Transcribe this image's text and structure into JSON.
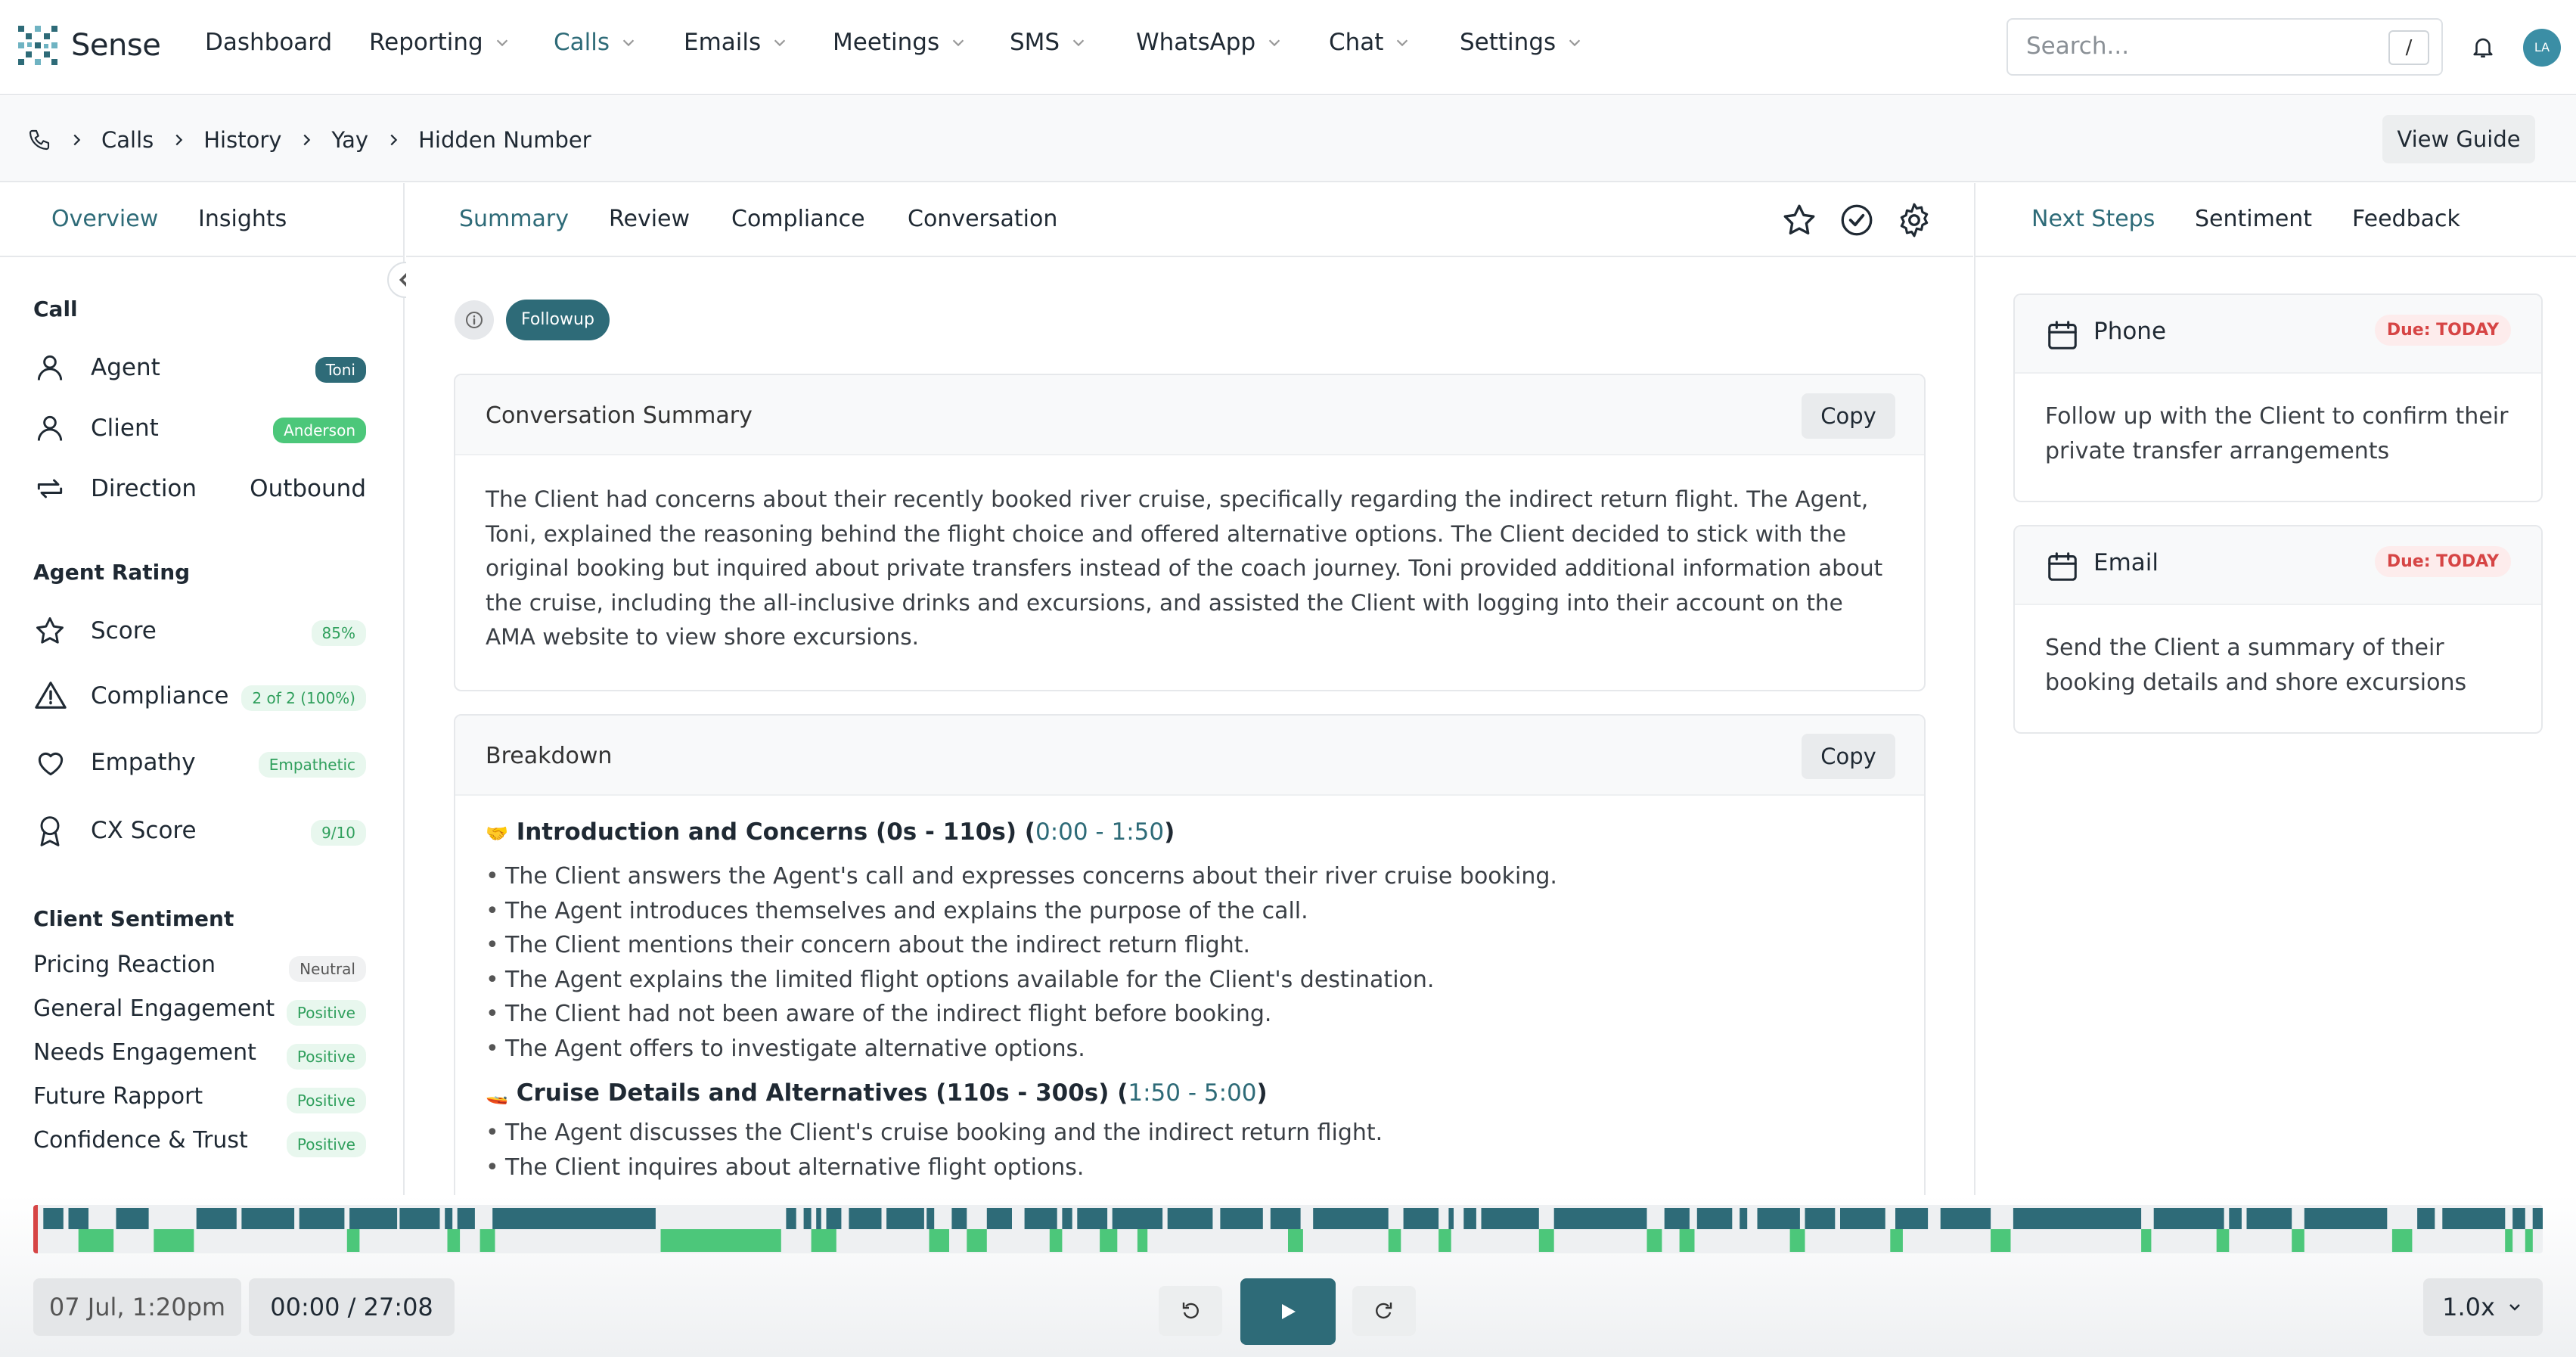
{
  "brand": {
    "name": "Sense"
  },
  "nav": {
    "items": [
      {
        "label": "Dashboard",
        "dropdown": false
      },
      {
        "label": "Reporting",
        "dropdown": true
      },
      {
        "label": "Calls",
        "dropdown": true,
        "active": true
      },
      {
        "label": "Emails",
        "dropdown": true
      },
      {
        "label": "Meetings",
        "dropdown": true
      },
      {
        "label": "SMS",
        "dropdown": true
      },
      {
        "label": "WhatsApp",
        "dropdown": true
      },
      {
        "label": "Chat",
        "dropdown": true
      },
      {
        "label": "Settings",
        "dropdown": true
      }
    ],
    "search_placeholder": "Search...",
    "search_shortcut": "/",
    "avatar_initials": "LA"
  },
  "breadcrumb": {
    "items": [
      "Calls",
      "History",
      "Yay",
      "Hidden Number"
    ],
    "view_guide": "View Guide"
  },
  "left": {
    "tabs": [
      "Overview",
      "Insights"
    ],
    "call_section": "Call",
    "call": {
      "agent_label": "Agent",
      "agent_value": "Toni",
      "client_label": "Client",
      "client_value": "Anderson",
      "direction_label": "Direction",
      "direction_value": "Outbound"
    },
    "rating_section": "Agent Rating",
    "rating": [
      {
        "label": "Score",
        "value": "85%",
        "icon": "star-icon"
      },
      {
        "label": "Compliance",
        "value": "2 of 2 (100%)",
        "icon": "warning-icon"
      },
      {
        "label": "Empathy",
        "value": "Empathetic",
        "icon": "heart-icon"
      },
      {
        "label": "CX Score",
        "value": "9/10",
        "icon": "award-icon"
      }
    ],
    "sentiment_section": "Client Sentiment",
    "sentiment": [
      {
        "label": "Pricing Reaction",
        "value": "Neutral"
      },
      {
        "label": "General Engagement",
        "value": "Positive"
      },
      {
        "label": "Needs Engagement",
        "value": "Positive"
      },
      {
        "label": "Future Rapport",
        "value": "Positive"
      },
      {
        "label": "Confidence & Trust",
        "value": "Positive"
      }
    ]
  },
  "center": {
    "tabs": [
      "Summary",
      "Review",
      "Compliance",
      "Conversation"
    ],
    "tag": "Followup",
    "summary": {
      "title": "Conversation Summary",
      "copy": "Copy",
      "text": "The Client had concerns about their recently booked river cruise, specifically regarding the indirect return flight. The Agent, Toni, explained the reasoning behind the flight choice and offered alternative options. The Client decided to stick with the original booking but inquired about private transfers instead of the coach journey. Toni provided additional information about the cruise, including the all-inclusive drinks and excursions, and assisted the Client with logging into their account on the AMA website to view shore excursions."
    },
    "breakdown": {
      "title": "Breakdown",
      "copy": "Copy",
      "sections": [
        {
          "emoji": "🤝",
          "heading": "Introduction and Concerns (0s - 110s) (",
          "timestamp": "0:00 - 1:50",
          "close": ")",
          "bullets": [
            "The Client answers the Agent's call and expresses concerns about their river cruise booking.",
            "The Agent introduces themselves and explains the purpose of the call.",
            "The Client mentions their concern about the indirect return flight.",
            "The Agent explains the limited flight options available for the Client's destination.",
            "The Client had not been aware of the indirect flight before booking.",
            "The Agent offers to investigate alternative options."
          ]
        },
        {
          "emoji": "🚤",
          "heading": "Cruise Details and Alternatives (110s - 300s) (",
          "timestamp": "1:50 - 5:00",
          "close": ")",
          "bullets": [
            "The Agent discusses the Client's cruise booking and the indirect return flight.",
            "The Client inquires about alternative flight options."
          ]
        }
      ]
    }
  },
  "right": {
    "tabs": [
      "Next Steps",
      "Sentiment",
      "Feedback"
    ],
    "steps": [
      {
        "type": "Phone",
        "due": "Due: TODAY",
        "text": "Follow up with the Client to confirm their private transfer arrangements"
      },
      {
        "type": "Email",
        "due": "Due: TODAY",
        "text": "Send the Client a summary of their booking details and shore excursions"
      }
    ]
  },
  "player": {
    "date": "07 Jul, 1:20pm",
    "time": "00:00 / 27:08",
    "speed": "1.0x",
    "progress": 0,
    "colors": {
      "agent": "#2e6b78",
      "client": "#4cc77a",
      "marker": "#d64545"
    }
  }
}
